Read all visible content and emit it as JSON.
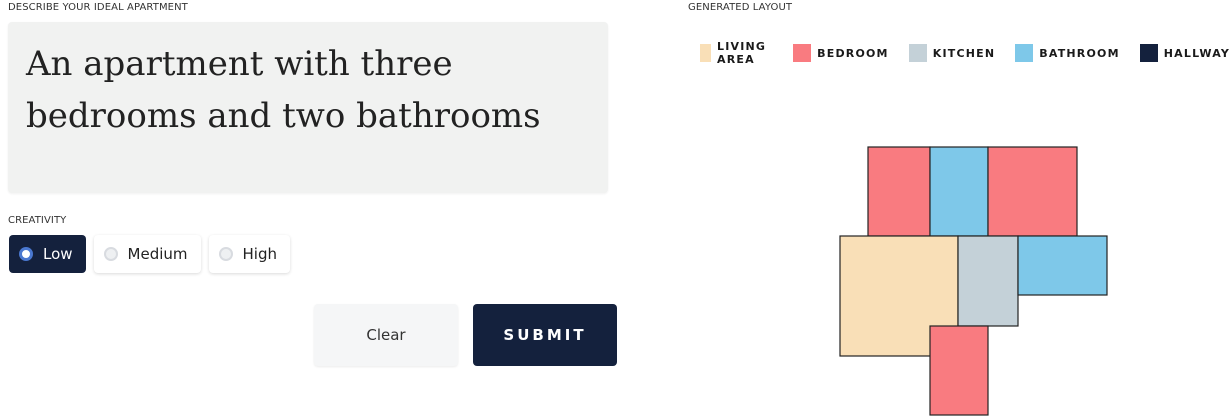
{
  "form": {
    "describe_label": "DESCRIBE YOUR IDEAL APARTMENT",
    "description": "An apartment with three bedrooms and two bathrooms",
    "creativity_label": "CREATIVITY",
    "creativity_options": [
      "Low",
      "Medium",
      "High"
    ],
    "creativity_selected": "Low",
    "clear_label": "Clear",
    "submit_label": "SUBMIT"
  },
  "layout": {
    "title": "GENERATED LAYOUT",
    "legend": [
      {
        "label": "LIVING AREA",
        "color": "#f9dfb7"
      },
      {
        "label": "BEDROOM",
        "color": "#f97b80"
      },
      {
        "label": "KITCHEN",
        "color": "#c4d1d8"
      },
      {
        "label": "BATHROOM",
        "color": "#7ec8e9"
      },
      {
        "label": "HALLWAY",
        "color": "#14213d"
      }
    ]
  },
  "colors": {
    "accent_dark": "#14213d",
    "radio_selected_ring": "#4a78d0"
  }
}
